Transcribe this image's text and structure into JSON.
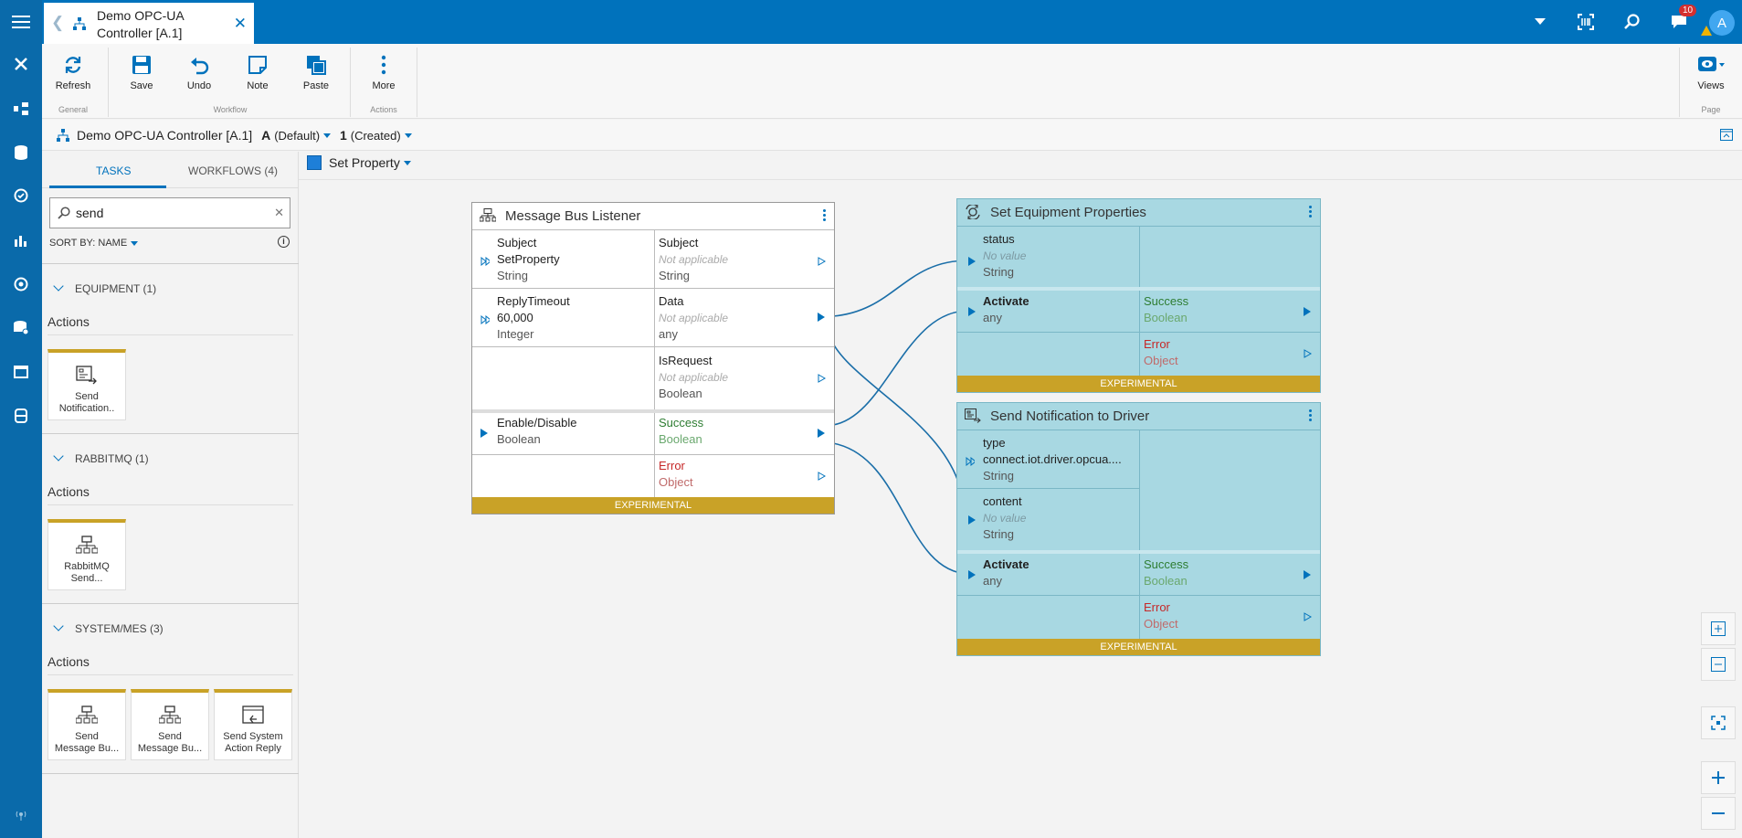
{
  "window": {
    "tab_title": "Demo OPC-UA Controller [A.1]",
    "notification_count": "10",
    "avatar_initial": "A"
  },
  "ribbon": {
    "refresh": "Refresh",
    "save": "Save",
    "undo": "Undo",
    "note": "Note",
    "paste": "Paste",
    "more": "More",
    "views": "Views",
    "groups": {
      "general": "General",
      "workflow": "Workflow",
      "actions": "Actions",
      "page": "Page"
    }
  },
  "breadcrumb": {
    "title": "Demo OPC-UA Controller [A.1]",
    "version_letter": "A",
    "version_label": "(Default)",
    "revision_number": "1",
    "revision_label": "(Created)"
  },
  "sidebar": {
    "tab_tasks": "TASKS",
    "tab_workflows": "WORKFLOWS (4)",
    "search_value": "send",
    "sort_prefix": "SORT BY:",
    "sort_value": "NAME",
    "sections": [
      {
        "title": "EQUIPMENT (1)",
        "actions_label": "Actions",
        "cards": [
          {
            "label1": "Send",
            "label2": "Notification.."
          }
        ]
      },
      {
        "title": "RABBITMQ (1)",
        "actions_label": "Actions",
        "cards": [
          {
            "label1": "RabbitMQ",
            "label2": "Send..."
          }
        ]
      },
      {
        "title": "SYSTEM/MES (3)",
        "actions_label": "Actions",
        "cards": [
          {
            "label1": "Send",
            "label2": "Message Bu..."
          },
          {
            "label1": "Send",
            "label2": "Message Bu..."
          },
          {
            "label1": "Send System",
            "label2": "Action Reply"
          }
        ]
      }
    ]
  },
  "canvas": {
    "page_name": "Set Property",
    "nodes": {
      "listener": {
        "title": "Message Bus Listener",
        "in_subject": {
          "name": "Subject",
          "value": "SetProperty",
          "type": "String"
        },
        "in_timeout": {
          "name": "ReplyTimeout",
          "value": "60,000",
          "type": "Integer"
        },
        "out_subject": {
          "name": "Subject",
          "value": "Not applicable",
          "type": "String"
        },
        "out_data": {
          "name": "Data",
          "value": "Not applicable",
          "type": "any"
        },
        "out_isrequest": {
          "name": "IsRequest",
          "value": "Not applicable",
          "type": "Boolean"
        },
        "in_enable": {
          "name": "Enable/Disable",
          "type": "Boolean"
        },
        "out_success": {
          "name": "Success",
          "type": "Boolean"
        },
        "out_error": {
          "name": "Error",
          "type": "Object"
        },
        "footer": "EXPERIMENTAL"
      },
      "setequip": {
        "title": "Set Equipment Properties",
        "in_status": {
          "name": "status",
          "value": "No value",
          "type": "String"
        },
        "in_activate": {
          "name": "Activate",
          "type": "any"
        },
        "out_success": {
          "name": "Success",
          "type": "Boolean"
        },
        "out_error": {
          "name": "Error",
          "type": "Object"
        },
        "footer": "EXPERIMENTAL"
      },
      "sendnotif": {
        "title": "Send Notification to Driver",
        "in_type": {
          "name": "type",
          "value": "connect.iot.driver.opcua....",
          "type": "String"
        },
        "in_content": {
          "name": "content",
          "value": "No value",
          "type": "String"
        },
        "in_activate": {
          "name": "Activate",
          "type": "any"
        },
        "out_success": {
          "name": "Success",
          "type": "Boolean"
        },
        "out_error": {
          "name": "Error",
          "type": "Object"
        },
        "footer": "EXPERIMENTAL"
      }
    }
  },
  "colors": {
    "brand": "#0072bc",
    "experimental": "#c9a227",
    "node_teal": "#a8d8e2"
  }
}
